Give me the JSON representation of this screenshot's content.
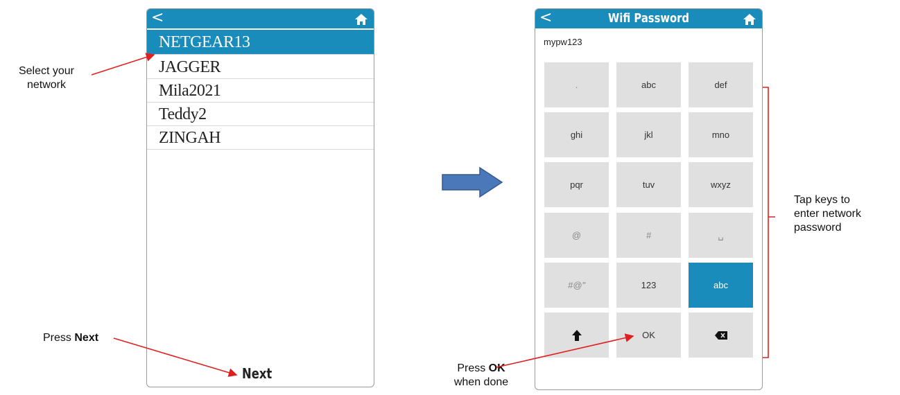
{
  "left_screen": {
    "back_icon": "chevron-left-icon",
    "home_icon": "home-icon",
    "networks": [
      "NETGEAR13",
      "JAGGER",
      "Mila2021",
      "Teddy2",
      "ZINGAH"
    ],
    "selected_index": 0,
    "next_label": "Next"
  },
  "right_screen": {
    "title": "Wifi Password",
    "password_value": "mypw123",
    "keys": [
      [
        ".",
        "abc",
        "def"
      ],
      [
        "ghi",
        "jkl",
        "mno"
      ],
      [
        "pqr",
        "tuv",
        "wxyz"
      ],
      [
        "@",
        "#",
        "␣"
      ],
      [
        "#@\"",
        "123",
        "abc"
      ],
      [
        "shift-icon",
        "OK",
        "backspace-icon"
      ]
    ],
    "active_key": "abc"
  },
  "annotations": {
    "select_network": [
      "Select your",
      "network"
    ],
    "press_next_prefix": "Press",
    "press_next_bold": "Next",
    "press_ok_prefix": "Press",
    "press_ok_bold": "OK",
    "press_ok_suffix": "when done",
    "tap_keys": [
      "Tap keys to",
      "enter network",
      "password"
    ]
  },
  "colors": {
    "accent": "#1a8cbc",
    "annotation_arrow": "#e02020",
    "flow_arrow": "#4a78b8"
  }
}
